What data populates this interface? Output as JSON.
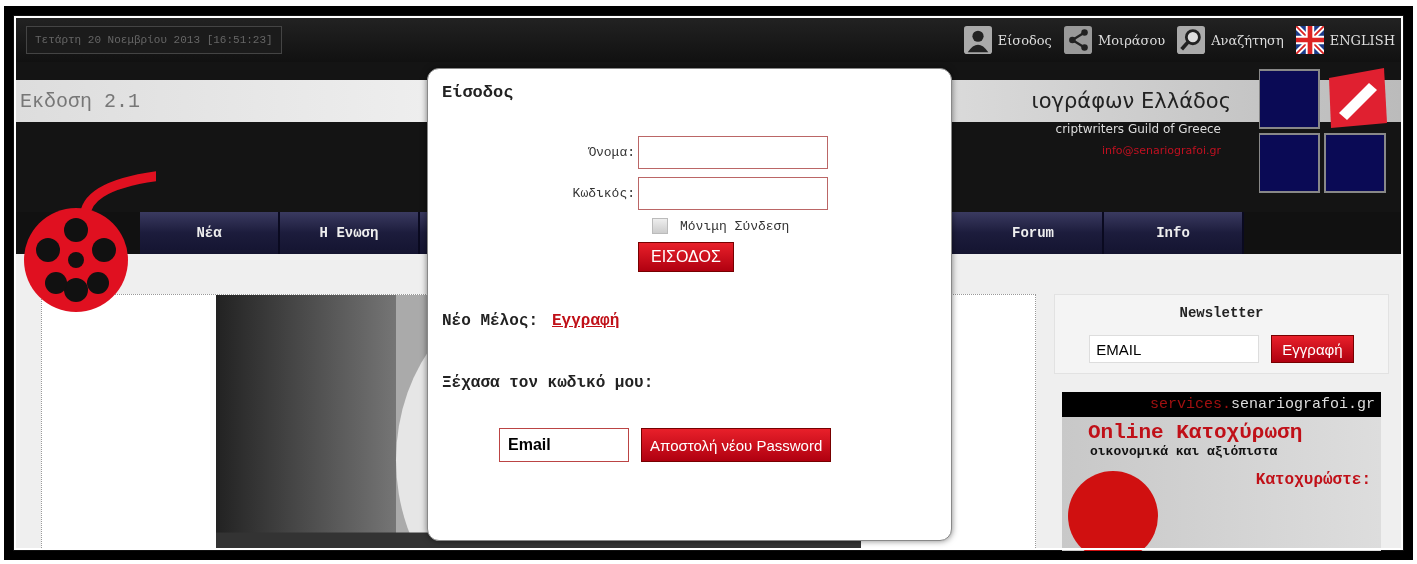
{
  "top_bar": {
    "date": "Τετάρτη 20 Νοεμβρίου 2013 [16:51:23]",
    "links": [
      {
        "kind": "user",
        "label": "Είσοδος"
      },
      {
        "kind": "share",
        "label": "Μοιράσου"
      },
      {
        "kind": "search",
        "label": "Αναζήτηση"
      },
      {
        "kind": "flag",
        "label": "ENGLISH"
      }
    ]
  },
  "header": {
    "version": "Εκδοση 2.1",
    "title": "ιογράφων Ελλάδος",
    "subtitle": "criptwriters Guild of Greece",
    "email": "info@senariografoi.gr"
  },
  "nav": {
    "left_items": [
      {
        "label": "Νέα"
      },
      {
        "label": "Η Ενωση"
      }
    ],
    "right_items": [
      {
        "label": "Forum"
      },
      {
        "label": "Info"
      }
    ]
  },
  "sidebar": {
    "newsletter": {
      "title": "Newsletter",
      "email_value": "EMAIL",
      "button": "Εγγραφή"
    },
    "ad": {
      "site_prefix": "services.",
      "site": "senariografoi.gr",
      "headline": "Online Κατοχύρωση",
      "tagline": "οικονομικά και αξιόπιστα",
      "cta": "Κατοχυρώστε:"
    }
  },
  "login_dialog": {
    "title": "Είσοδος",
    "username_label": "Όνομα:",
    "password_label": "Κωδικός:",
    "remember": {
      "label": "Μόνιμη Σύνδεση",
      "checked": false
    },
    "submit": "ΕΙΣΟΔΟΣ",
    "new_member_label": "Νέο Μέλος:",
    "register_link": "Εγγραφή",
    "forgot_label": "Ξέχασα τον κωδικό μου:",
    "email_value": "Email",
    "send_button": "Αποστολή νέου Password"
  }
}
